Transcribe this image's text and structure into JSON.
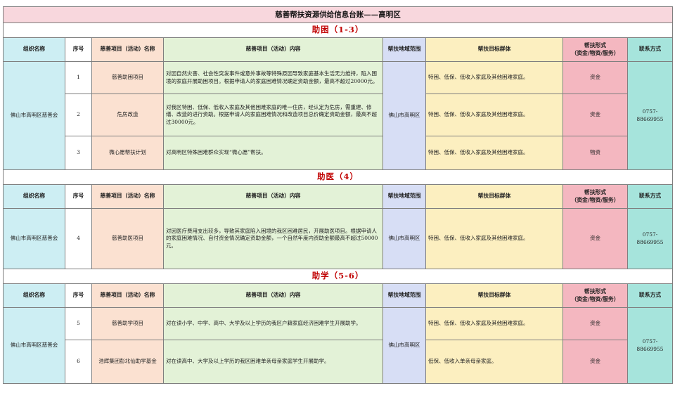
{
  "title": "慈善帮扶资源供给信息台账——高明区",
  "headers": {
    "org": "组织名称",
    "no": "序号",
    "name": "慈善项目（活动）名称",
    "content": "慈善项目（活动）内容",
    "area": "帮扶地域范围",
    "target": "帮扶目标群体",
    "form": "帮扶形式\n（资金/物资/服务）",
    "contact": "联系方式"
  },
  "sections": [
    {
      "title": "助困（1-3）",
      "org": "佛山市高明区慈善会",
      "area": "佛山市高明区",
      "contact": "0757-88669955",
      "rows": [
        {
          "no": "1",
          "name": "慈善助困项目",
          "content": "对因自然灾害、社会性突发事件或意外事故等特殊原因导致家庭基本生活无力维持，陷入困境的家庭开展助困项目。根据申请人的家庭困难情况确定资助金额，最高不超过20000元。",
          "target": "特困、低保、低收入家庭及其他困难家庭。",
          "form": "资金"
        },
        {
          "no": "2",
          "name": "危房改造",
          "content": "对我区特困、低保、低收入家庭及其他困难家庭的唯一住房，经认定为危房，需重建、修缮、改造的进行资助。根据申请人的家庭困难情况和改造项目总价确定资助金额，最高不超过30000元。",
          "target": "特困、低保、低收入家庭及其他困难家庭。",
          "form": "资金"
        },
        {
          "no": "3",
          "name": "微心愿帮扶计划",
          "content": "对高明区特殊困难群众实现“微心愿”帮扶。",
          "target": "特困、低保、低收入家庭及其他困难家庭。",
          "form": "物资"
        }
      ]
    },
    {
      "title": "助医（4）",
      "org": "佛山市高明区慈善会",
      "area": "佛山市高明区",
      "contact": "0757-88669955",
      "rows": [
        {
          "no": "4",
          "name": "慈善助医项目",
          "content": "对因医疗费用支出较多，导致其家庭陷入困境的我区困难居民，开展助医项目。根据申请人的家庭困难情况、自付资金情况确定资助金额，一个自然年度内资助金额最高不超过50000元。",
          "target": "特困、低保、低收入家庭及其他困难家庭。",
          "form": "资金"
        }
      ]
    },
    {
      "title": "助学（5-6）",
      "org": "佛山市高明区慈善会",
      "area": "佛山市高明区",
      "contact": "0757-88669955",
      "rows": [
        {
          "no": "5",
          "name": "慈善助学项目",
          "content": "对在读小学、中学、高中、大学及以上学历的我区户籍家庭经济困难学生开展助学。",
          "target": "特困、低保、低收入家庭及其他困难家庭。",
          "form": "资金"
        },
        {
          "no": "6",
          "name": "浩辉集团彭北仙助学基金",
          "content": "对在读高中、大学及以上学历的我区困难单亲母亲家庭学生开展助学。",
          "target": "低保、低收入单亲母亲家庭。",
          "form": "资金"
        }
      ]
    }
  ]
}
